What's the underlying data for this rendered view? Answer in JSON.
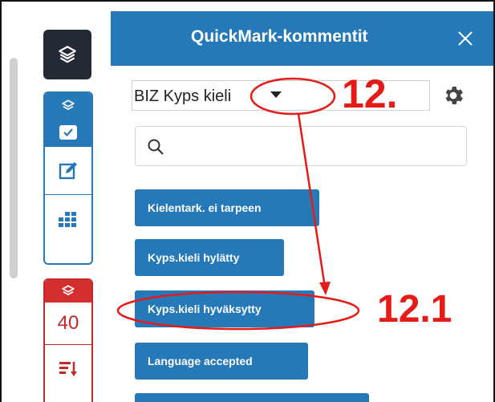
{
  "header": {
    "title": "QuickMark-kommentit"
  },
  "selector": {
    "selected": "BIZ Kyps kieli"
  },
  "search": {
    "placeholder": "",
    "value": ""
  },
  "toolbar": {
    "count": "40"
  },
  "quickmarks": [
    {
      "label": "Kielentark. ei tarpeen"
    },
    {
      "label": "Kyps.kieli hylätty"
    },
    {
      "label": "Kyps.kieli hyväksytty"
    },
    {
      "label": "Language accepted"
    }
  ],
  "annotations": {
    "a12": "12.",
    "a121": "12.1"
  },
  "colors": {
    "accent": "#2679b9",
    "dark": "#232a36",
    "danger": "#d32f2f",
    "annotation": "#e51b17"
  },
  "icons": [
    "layers-icon",
    "checkbox-icon",
    "edit-icon",
    "grid-icon",
    "sort-icon",
    "gear-icon",
    "search-icon",
    "close-icon",
    "chevron-down-icon"
  ]
}
